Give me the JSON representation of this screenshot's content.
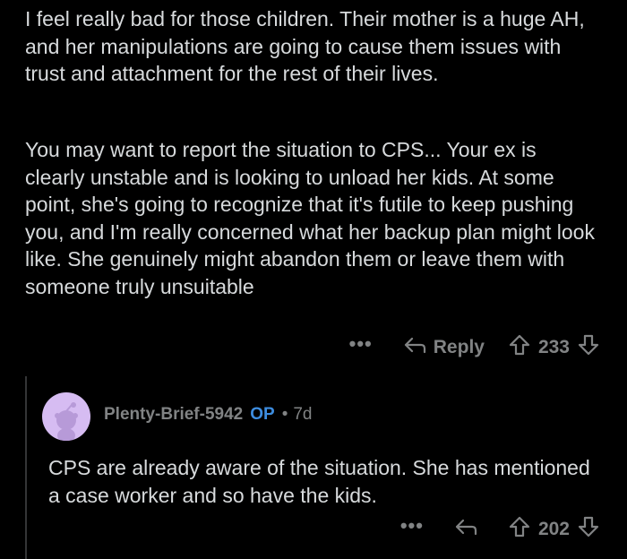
{
  "comment": {
    "paragraphs": [
      "I feel really bad for those children. Their mother is a huge AH, and her manipulations are going to cause them issues with trust and attachment for the rest of their lives.",
      "You may want to report the situation to CPS... Your ex is clearly unstable and is looking to unload her kids. At some point, she's going to recognize that it's futile to keep pushing you, and I'm really concerned what her backup plan might look like. She genuinely might abandon them or leave them with someone truly unsuitable"
    ],
    "actions": {
      "more": "•••",
      "reply_label": "Reply",
      "score": "233"
    }
  },
  "reply": {
    "username": "Plenty-Brief-5942",
    "op_badge": "OP",
    "separator": "•",
    "age": "7d",
    "body": "CPS are already aware of the situation. She has mentioned a case worker and so have the kids.",
    "actions": {
      "more": "•••",
      "score": "202"
    }
  },
  "colors": {
    "background": "#000000",
    "text": "#d7dadc",
    "muted": "#818384",
    "op": "#3d8de0",
    "avatar_bg": "#d6bcf2"
  }
}
